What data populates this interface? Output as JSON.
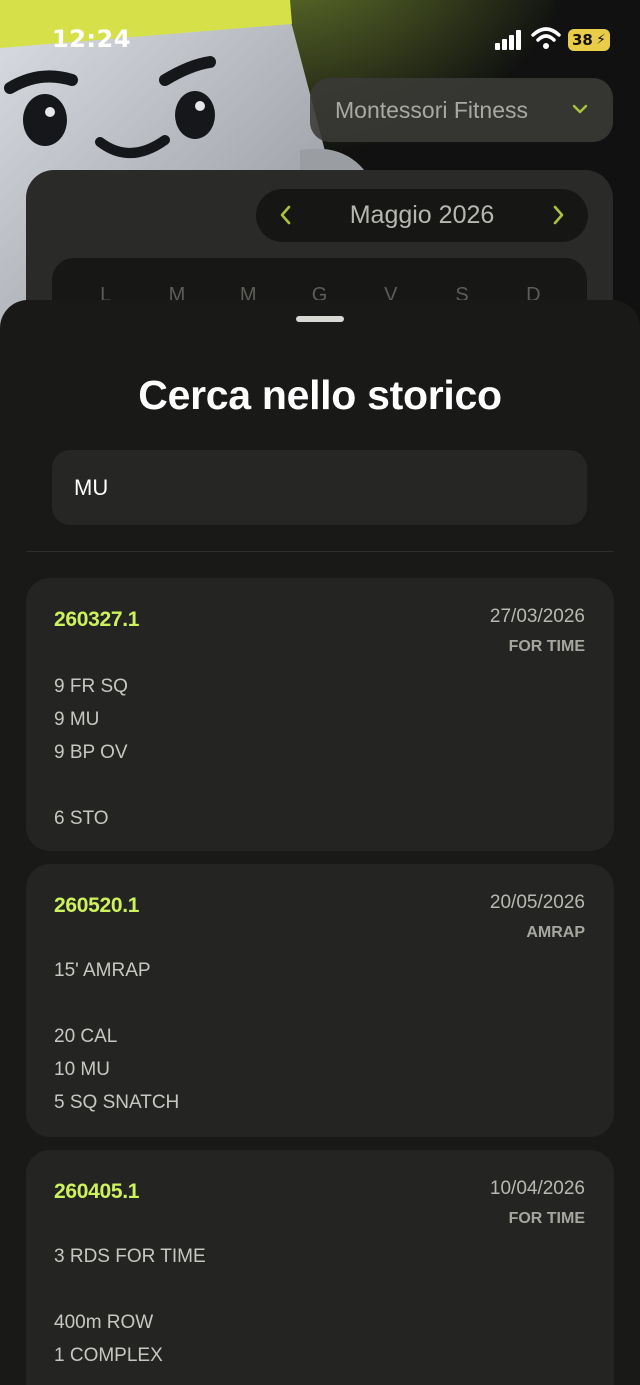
{
  "status": {
    "time": "12:24",
    "battery": "38"
  },
  "header": {
    "gym": "Montessori Fitness",
    "month": "Maggio 2026",
    "weekdays": [
      "L",
      "M",
      "M",
      "G",
      "V",
      "S",
      "D"
    ]
  },
  "sheet": {
    "title": "Cerca nello storico",
    "search_value": "MU"
  },
  "results": [
    {
      "code": "260327.1",
      "date": "27/03/2026",
      "type": "FOR TIME",
      "lines": [
        "9 FR SQ",
        "9 MU",
        "9 BP OV",
        "",
        "6 STO"
      ]
    },
    {
      "code": "260520.1",
      "date": "20/05/2026",
      "type": "AMRAP",
      "lines": [
        "15' AMRAP",
        "",
        "20 CAL",
        "10 MU",
        "5 SQ SNATCH"
      ]
    },
    {
      "code": "260405.1",
      "date": "10/04/2026",
      "type": "FOR TIME",
      "lines": [
        "3 RDS FOR TIME",
        "",
        "400m ROW",
        "1 COMPLEX"
      ]
    }
  ],
  "colors": {
    "accent": "#cdf25c",
    "sheet_bg": "#191918",
    "card_bg": "#242422",
    "battery": "#e9cc48"
  }
}
